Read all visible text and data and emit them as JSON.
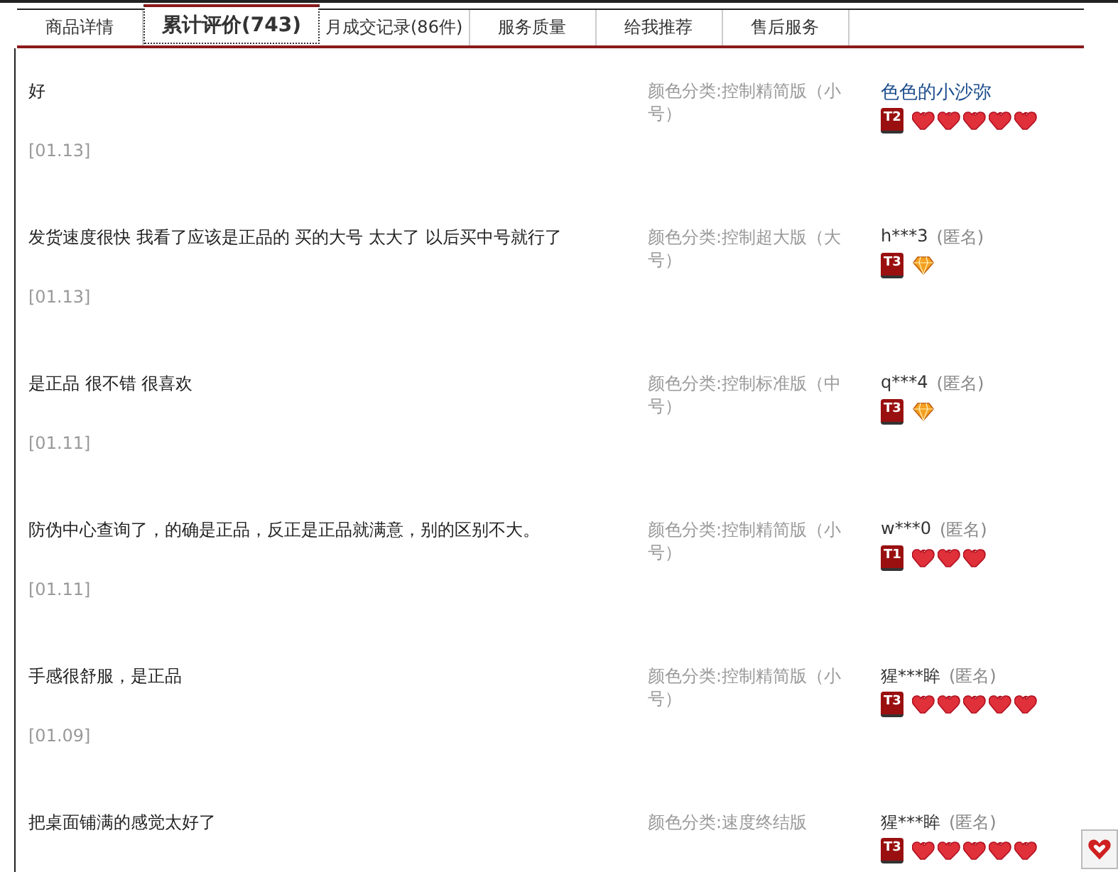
{
  "tabs": [
    {
      "label": "商品详情",
      "selected": false
    },
    {
      "label": "累计评价(743)",
      "selected": true
    },
    {
      "label": "月成交记录(86件)",
      "selected": false
    },
    {
      "label": "服务质量",
      "selected": false
    },
    {
      "label": "给我推荐",
      "selected": false
    },
    {
      "label": "售后服务",
      "selected": false
    }
  ],
  "reviews": [
    {
      "comment": "好",
      "date": "[01.13]",
      "spec": "颜色分类:控制精简版（小号）",
      "reviewer": {
        "name": "色色的小沙弥",
        "kind": "member",
        "level": "T2",
        "marks": [
          {
            "kind": "heart"
          },
          {
            "kind": "heart"
          },
          {
            "kind": "heart"
          },
          {
            "kind": "heart"
          },
          {
            "kind": "heart"
          }
        ]
      }
    },
    {
      "comment": "发货速度很快  我看了应该是正品的  买的大号  太大了  以后买中号就行了",
      "date": "[01.13]",
      "spec": "颜色分类:控制超大版（大号）",
      "reviewer": {
        "name": "h***3",
        "kind": "anonymous",
        "note": "(匿名)",
        "level": "T3",
        "marks": [
          {
            "kind": "diamond"
          }
        ]
      }
    },
    {
      "comment": "是正品  很不错  很喜欢",
      "date": "[01.11]",
      "spec": "颜色分类:控制标准版（中号）",
      "reviewer": {
        "name": "q***4",
        "kind": "anonymous",
        "note": "(匿名)",
        "level": "T3",
        "marks": [
          {
            "kind": "diamond"
          }
        ]
      }
    },
    {
      "comment": "防伪中心查询了，的确是正品，反正是正品就满意，别的区别不大。",
      "date": "[01.11]",
      "spec": "颜色分类:控制精简版（小号）",
      "reviewer": {
        "name": "w***0",
        "kind": "anonymous",
        "note": "(匿名)",
        "level": "T1",
        "marks": [
          {
            "kind": "heart"
          },
          {
            "kind": "heart"
          },
          {
            "kind": "heart"
          }
        ]
      }
    },
    {
      "comment": "手感很舒服，是正品",
      "date": "[01.09]",
      "spec": "颜色分类:控制精简版（小号）",
      "reviewer": {
        "name": "猩***眸",
        "kind": "anonymous",
        "note": "(匿名)",
        "level": "T3",
        "marks": [
          {
            "kind": "heart"
          },
          {
            "kind": "heart"
          },
          {
            "kind": "heart"
          },
          {
            "kind": "heart"
          },
          {
            "kind": "heart"
          }
        ]
      }
    },
    {
      "comment": "把桌面铺满的感觉太好了",
      "spec": "颜色分类:速度终结版",
      "reviewer": {
        "name": "猩***眸",
        "kind": "anonymous",
        "note": "(匿名)",
        "level": "T3",
        "marks": [
          {
            "kind": "heart"
          },
          {
            "kind": "heart"
          },
          {
            "kind": "heart"
          },
          {
            "kind": "heart"
          },
          {
            "kind": "heart"
          }
        ]
      }
    }
  ]
}
